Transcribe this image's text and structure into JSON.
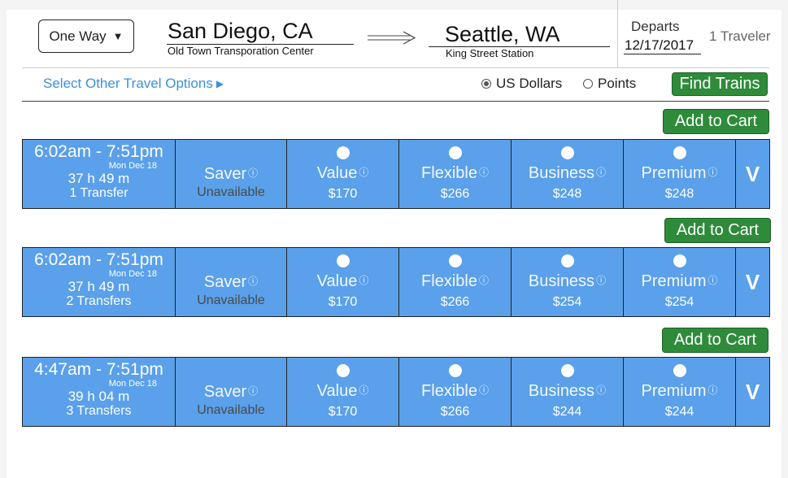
{
  "search": {
    "trip_type": "One Way",
    "origin": {
      "city": "San Diego, CA",
      "station": "Old Town Transporation Center"
    },
    "destination": {
      "city": "Seattle, WA",
      "station": "King Street Station"
    },
    "departs_label": "Departs",
    "departs_date": "12/17/2017",
    "travelers": "1 Traveler"
  },
  "options_bar": {
    "other_options": "Select Other Travel Options",
    "currency_usd": "US Dollars",
    "currency_points": "Points",
    "selected_currency": "usd",
    "find_button": "Find Trains"
  },
  "labels": {
    "add_to_cart": "Add to Cart",
    "expand": "V",
    "info": "ⓘ"
  },
  "fare_classes": [
    "Saver",
    "Value",
    "Flexible",
    "Business",
    "Premium"
  ],
  "results": [
    {
      "time_range": "6:02am - 7:51pm",
      "date": "Mon Dec 18",
      "duration": "37 h 49 m",
      "transfers": "1 Transfer",
      "fares": [
        "Unavailable",
        "$170",
        "$266",
        "$248",
        "$248"
      ]
    },
    {
      "time_range": "6:02am - 7:51pm",
      "date": "Mon Dec 18",
      "duration": "37 h 49 m",
      "transfers": "2 Transfers",
      "fares": [
        "Unavailable",
        "$170",
        "$266",
        "$254",
        "$254"
      ]
    },
    {
      "time_range": "4:47am - 7:51pm",
      "date": "Mon Dec 18",
      "duration": "39 h 04 m",
      "transfers": "3 Transfers",
      "fares": [
        "Unavailable",
        "$170",
        "$266",
        "$244",
        "$244"
      ]
    }
  ],
  "colors": {
    "row_blue": "#5aa0ea",
    "button_green": "#2e8b3a",
    "link_blue": "#3b8fe0"
  }
}
